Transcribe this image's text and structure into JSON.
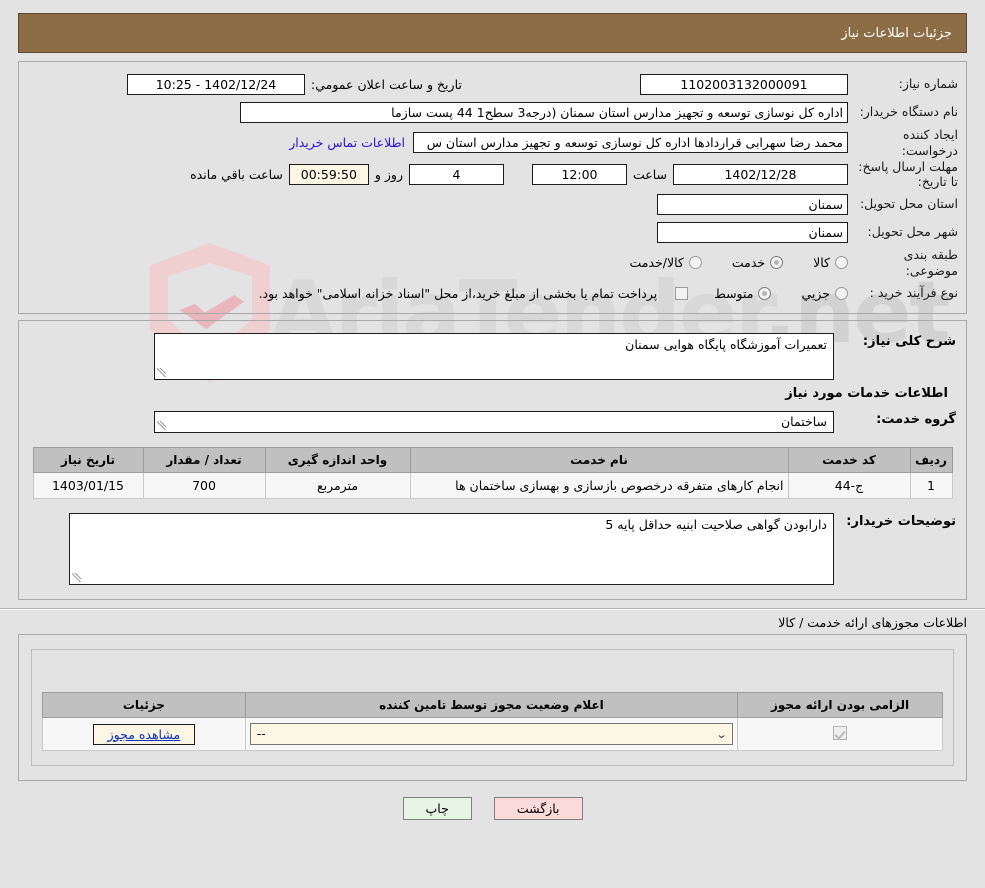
{
  "window": {
    "title": "جزئیات اطلاعات نیاز"
  },
  "watermark": {
    "text": "AriaTender",
    "suffix": ".net"
  },
  "summary": {
    "need_number_label": "شماره نیاز:",
    "need_number_value": "1102003132000091",
    "announce_label": "تاریخ و ساعت اعلان عمومي:",
    "announce_value": "1402/12/24 - 10:25",
    "buyer_org_label": "نام دستگاه خریدار:",
    "buyer_org_value": "اداره کل نوسازی   توسعه و تجهیز مدارس استان سمنان (درجه3  سطح1  44 پست سازما",
    "creator_label": "ایجاد کننده درخواست:",
    "creator_value": "محمد رضا سهرابی قراردادها اداره کل نوسازی   توسعه و تجهیز مدارس استان س",
    "contact_link": "اطلاعات تماس خریدار",
    "deadline_label": "مهلت ارسال پاسخ: تا تاریخ:",
    "deadline_date": "1402/12/28",
    "time_label": "ساعت",
    "deadline_time": "12:00",
    "days_value": "4",
    "days_label": "روز و",
    "countdown_value": "00:59:50",
    "countdown_label": "ساعت باقي مانده",
    "province_label": "استان محل تحویل:",
    "province_value": "سمنان",
    "city_label": "شهر محل تحویل:",
    "city_value": "سمنان",
    "category_label": "طبقه بندی موضوعی:",
    "category_options": [
      "کالا",
      "خدمت",
      "کالا/خدمت"
    ],
    "category_selected": "خدمت",
    "process_label": "نوع فرآیند خرید :",
    "process_options": [
      "جزیي",
      "متوسط"
    ],
    "process_selected": "متوسط",
    "treasury_note": "پرداخت تمام یا بخشی از مبلغ خرید،از محل \"اسناد خزانه اسلامی\" خواهد بود."
  },
  "details": {
    "general_label": "شرح کلی نیاز:",
    "general_value": "تعمیرات آموزشگاه پایگاه هوایی سمنان",
    "services_heading": "اطلاعات خدمات مورد نیاز",
    "group_label": "گروه خدمت:",
    "group_value": "ساختمان",
    "table": {
      "headers": [
        "ردیف",
        "کد خدمت",
        "نام خدمت",
        "واحد اندازه گیری",
        "تعداد / مقدار",
        "تاریخ نیاز"
      ],
      "rows": [
        [
          "1",
          "ج-44",
          "انجام کارهای متفرقه درخصوص بازسازی و بهسازی ساختمان ها",
          "مترمربع",
          "700",
          "1403/01/15"
        ]
      ]
    },
    "buyer_notes_label": "توضیحات خریدار:",
    "buyer_notes_value": "دارابودن گواهی صلاحیت ابنیه حداقل پایه 5"
  },
  "permits": {
    "section_title": "اطلاعات مجوزهای ارائه خدمت / کالا",
    "headers": [
      "الزامی بودن ارائه مجوز",
      "اعلام وضعیت مجوز توسط تامین کننده",
      "جزئیات"
    ],
    "rows": [
      {
        "required": true,
        "status": "--",
        "details_label": "مشاهده مجوز"
      }
    ]
  },
  "footer": {
    "print_label": "چاپ",
    "back_label": "بازگشت"
  }
}
